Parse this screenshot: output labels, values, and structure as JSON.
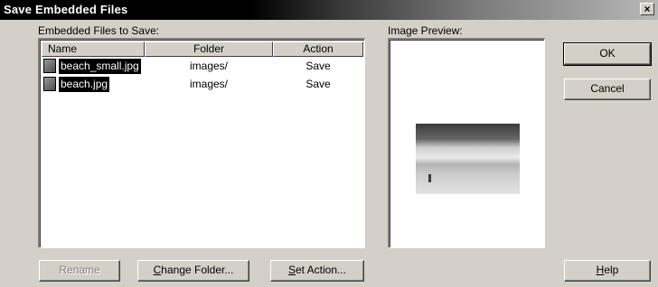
{
  "window": {
    "title": "Save Embedded Files",
    "close_label": "×"
  },
  "list": {
    "label": "Embedded Files to Save:",
    "columns": {
      "name": "Name",
      "folder": "Folder",
      "action": "Action"
    },
    "rows": [
      {
        "name": "beach_small.jpg",
        "folder": "images/",
        "action": "Save",
        "icon": "image-file-icon"
      },
      {
        "name": "beach.jpg",
        "folder": "images/",
        "action": "Save",
        "icon": "image-file-icon"
      }
    ]
  },
  "preview": {
    "label": "Image Preview:"
  },
  "buttons": {
    "ok": "OK",
    "cancel": "Cancel",
    "rename": "Rename",
    "change_folder_mnemonic": "C",
    "change_folder_rest": "hange Folder...",
    "set_action_mnemonic": "S",
    "set_action_rest": "et Action...",
    "help_mnemonic": "H",
    "help_rest": "elp"
  }
}
